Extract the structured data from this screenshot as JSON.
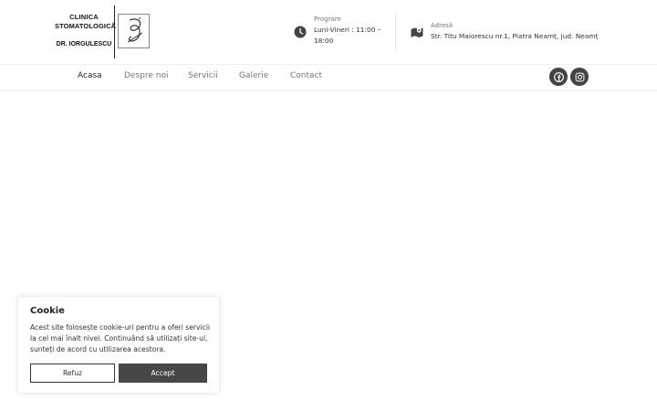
{
  "logo": {
    "line1": "CLINICA",
    "line2": "STOMATOLOGICĂ",
    "line3": "DR. IORGULESCU"
  },
  "info": {
    "hours": {
      "title": "Program",
      "value": "Luni-Vineri : 11:00 – 18:00",
      "icon": "clock-icon"
    },
    "address": {
      "title": "Adresă",
      "value": "Str. Titu Maiorescu nr.1, Piatra Neamț, jud. Neamț",
      "icon": "map-icon"
    }
  },
  "nav": {
    "items": [
      "Acasa",
      "Despre noi",
      "Servicii",
      "Galerie",
      "Contact"
    ],
    "active": "Acasa",
    "social": [
      "facebook-icon",
      "instagram-icon"
    ]
  },
  "cookie": {
    "title": "Cookie",
    "text": "Acest site folosește cookie-uri pentru a oferi servicii la cel mai înalt nivel. Continuând să utilizați site-ul, sunteți de acord cu utilizarea acestora.",
    "refuse_label": "Refuz",
    "accept_label": "Accept"
  },
  "colors": {
    "accent_dark": "#474747",
    "social_bg": "#444444"
  }
}
